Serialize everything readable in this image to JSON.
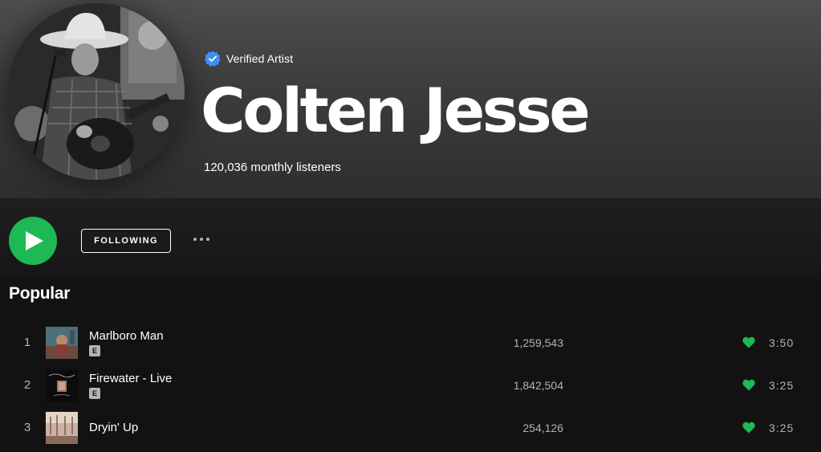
{
  "artist": {
    "verified_label": "Verified Artist",
    "name": "Colten Jesse",
    "monthly_listeners": "120,036 monthly listeners"
  },
  "actions": {
    "follow_label": "FOLLOWING"
  },
  "popular": {
    "title": "Popular",
    "tracks": [
      {
        "number": "1",
        "title": "Marlboro Man",
        "explicit": "E",
        "plays": "1,259,543",
        "liked": true,
        "duration": "3:50"
      },
      {
        "number": "2",
        "title": "Firewater - Live",
        "explicit": "E",
        "plays": "1,842,504",
        "liked": true,
        "duration": "3:25"
      },
      {
        "number": "3",
        "title": "Dryin' Up",
        "explicit": "",
        "plays": "254,126",
        "liked": true,
        "duration": "3:25"
      }
    ]
  },
  "colors": {
    "accent_green": "#1db954",
    "verified_blue": "#3d91f4",
    "background": "#121212",
    "muted_text": "#b3b3b3"
  },
  "icons": [
    "verified-badge-icon",
    "play-icon",
    "more-options-icon",
    "heart-icon",
    "explicit-icon"
  ]
}
